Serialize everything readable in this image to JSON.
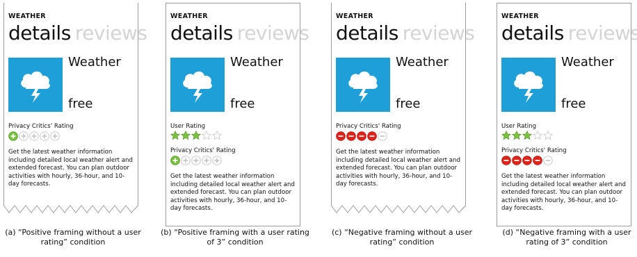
{
  "header": "WEATHER",
  "pivots": {
    "details": "details",
    "reviews": "reviews"
  },
  "app": {
    "name": "Weather",
    "price": "free",
    "icon": "cloud-lightning-icon",
    "icon_color": "#1f9fd8"
  },
  "labels": {
    "user_rating": "User Rating",
    "privacy_rating": "Privacy Critics' Rating"
  },
  "description": "Get the latest weather information including detailed local weather alert and extended forecast. You can plan outdoor activities with hourly, 36-hour, and 10-day forecasts.",
  "colors": {
    "positive": "#7cc242",
    "negative": "#e2231a",
    "star_filled": "#7cc242",
    "empty": "#c8c8c8"
  },
  "panels": [
    {
      "caption": "(a) “Positive framing without a user rating” condition",
      "user_rating": null,
      "privacy": {
        "framing": "positive",
        "filled": 1,
        "of": 5
      }
    },
    {
      "caption": "(b) “Positive framing with a user rating of 3” condition",
      "user_rating": {
        "filled": 3,
        "of": 5
      },
      "privacy": {
        "framing": "positive",
        "filled": 1,
        "of": 5
      }
    },
    {
      "caption": "(c) “Negative framing without a user rating” condition",
      "user_rating": null,
      "privacy": {
        "framing": "negative",
        "filled": 4,
        "of": 5
      }
    },
    {
      "caption": "(d) “Negative framing with a user rating of 3” condition",
      "user_rating": {
        "filled": 3,
        "of": 5
      },
      "privacy": {
        "framing": "negative",
        "filled": 4,
        "of": 5
      }
    }
  ]
}
